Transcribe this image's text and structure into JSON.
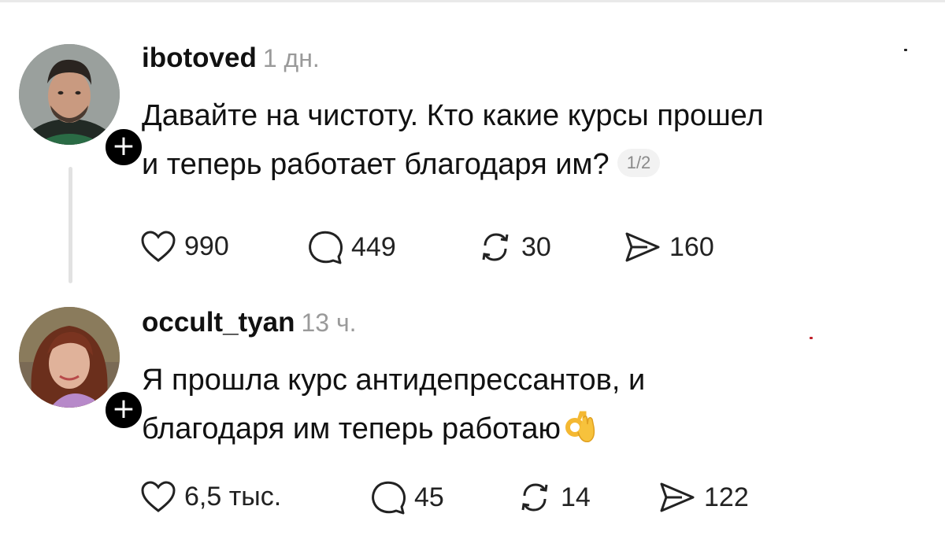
{
  "posts": [
    {
      "username": "ibotoved",
      "time": "1 дн.",
      "text_line1": "Давайте на чистоту. Кто какие курсы прошел",
      "text_line2": "и теперь работает благодаря им?",
      "page_indicator": "1/2",
      "follow_label": "+",
      "likes": "990",
      "comments": "449",
      "reposts": "30",
      "shares": "160"
    },
    {
      "username": "occult_tyan",
      "time": "13 ч.",
      "text_line1": "Я прошла курс антидепрессантов, и",
      "text_line2": "благодаря им теперь работаю",
      "emoji": "ok-hand-emoji",
      "follow_label": "+",
      "likes": "6,5 тыс.",
      "comments": "45",
      "reposts": "14",
      "shares": "122"
    }
  ],
  "icons": {
    "like": "heart-icon",
    "comment": "comment-bubble-icon",
    "repost": "repost-icon",
    "share": "share-icon"
  },
  "colors": {
    "text": "#111111",
    "muted": "#9a9a9a",
    "thread_line": "#e2e2e2",
    "badge": "#000000"
  }
}
